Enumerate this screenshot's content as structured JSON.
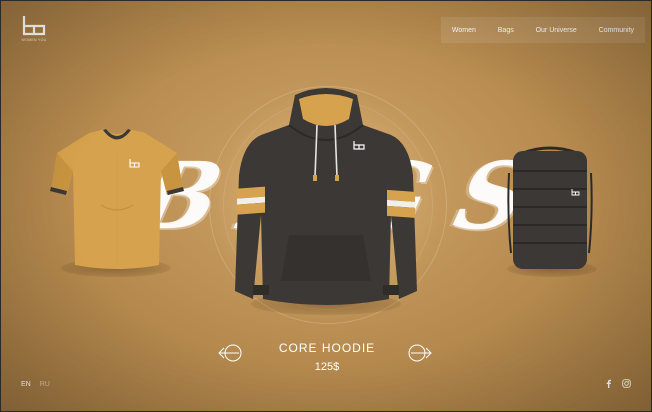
{
  "logo": {
    "text": "WOMEN YOU"
  },
  "nav": {
    "items": [
      {
        "label": "Women"
      },
      {
        "label": "Bags"
      },
      {
        "label": "Our Universe"
      },
      {
        "label": "Community"
      }
    ]
  },
  "background_word": "BAGS",
  "products": {
    "left": {
      "icon": "tshirt"
    },
    "center": {
      "icon": "hoodie"
    },
    "right": {
      "icon": "backpack"
    }
  },
  "current": {
    "name": "CORE HOODIE",
    "price": "125$"
  },
  "carousel": {
    "prev_icon": "arrow-left-icon",
    "next_icon": "arrow-right-icon"
  },
  "footer": {
    "languages": [
      {
        "label": "EN",
        "active": true
      },
      {
        "label": "RU",
        "active": false
      }
    ],
    "social": [
      "facebook-icon",
      "instagram-icon"
    ]
  },
  "colors": {
    "background": "#b98d4f",
    "hoodie": "#3b3835",
    "accent": "#d8a85e",
    "text": "#ffffff"
  }
}
